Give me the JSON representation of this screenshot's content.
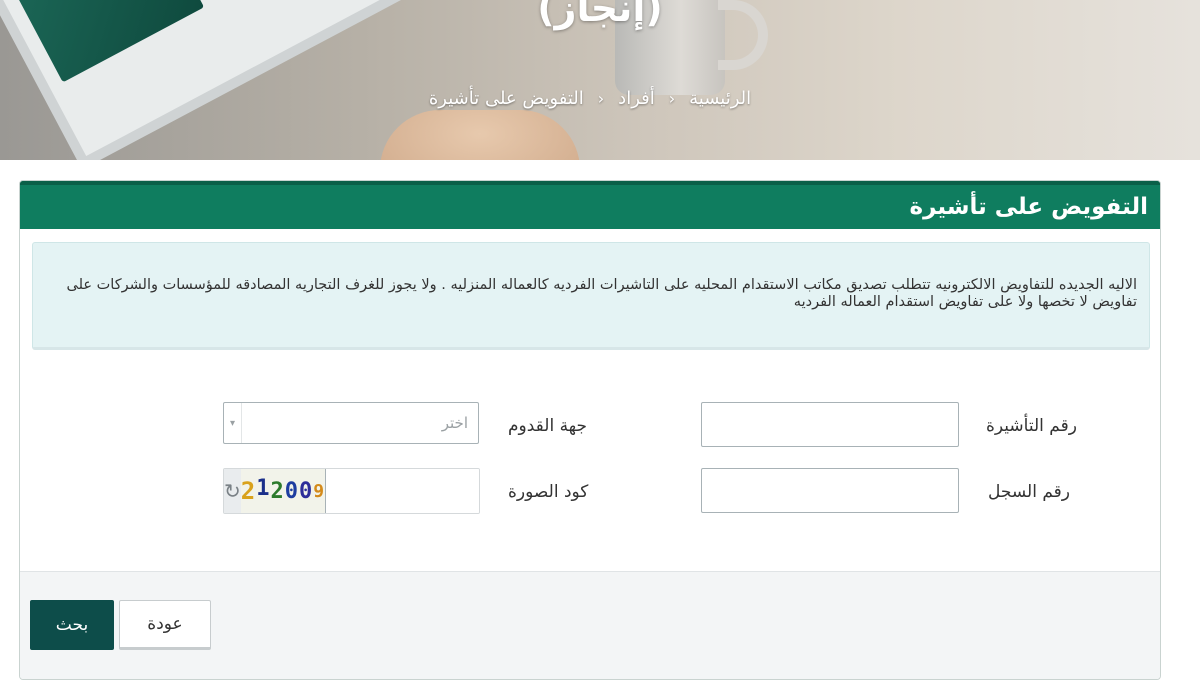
{
  "hero": {
    "title": "(إنجاز)",
    "breadcrumb": [
      "الرئيسية",
      "أفراد",
      "التفويض على تأشيرة"
    ]
  },
  "card": {
    "title": "التفويض على تأشيرة",
    "notice": "الاليه الجديده للتفاويض الالكترونيه تتطلب تصديق مكاتب الاستقدام المحليه على التاشيرات الفرديه كالعماله المنزليه . ولا يجوز للغرف التجاريه المصادقه للمؤسسات والشركات على تفاويض لا تخصها ولا على تفاويض استقدام العماله الفرديه"
  },
  "form": {
    "visa_number_label": "رقم التأشيرة",
    "visa_number_value": "",
    "arrival_label": "جهة القدوم",
    "arrival_selected": "اختر",
    "record_number_label": "رقم السجل",
    "record_number_value": "",
    "captcha_label": "كود الصورة",
    "captcha_digits": [
      "2",
      "1",
      "2",
      "0",
      "0",
      "9"
    ],
    "captcha_value": "",
    "refresh_icon": "↻"
  },
  "buttons": {
    "search_label": "بحث",
    "back_label": "عودة"
  },
  "colors": {
    "header_green": "#0f7d5f",
    "search_button": "#0d4d4a",
    "notice_bg": "#e4f3f4"
  }
}
